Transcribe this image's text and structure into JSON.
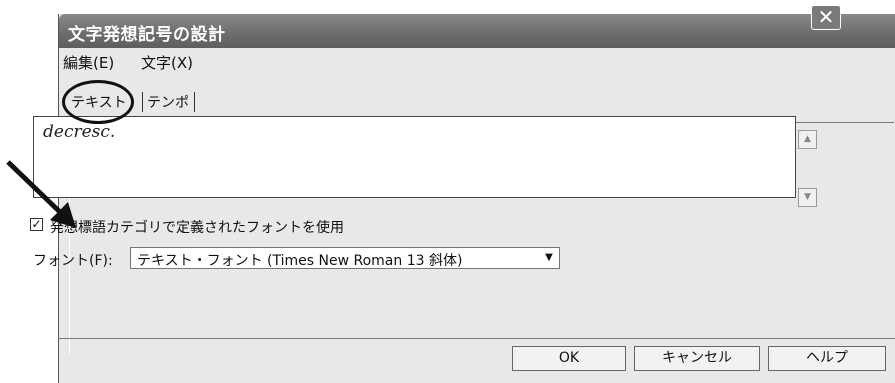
{
  "window": {
    "title": "文字発想記号の設計",
    "close_icon": "close-icon"
  },
  "menu": {
    "edit": "編集(E)",
    "char": "文字(X)"
  },
  "tabs": [
    {
      "label": "テキスト"
    },
    {
      "label": "テンポ"
    }
  ],
  "text_area": {
    "value": "decresc."
  },
  "checkbox": {
    "checked": true,
    "mark": "✓",
    "label": "発想標語カテゴリで定義されたフォントを使用"
  },
  "font": {
    "label": "フォント(F):",
    "value": "テキスト・フォント (Times New Roman 13 斜体)"
  },
  "buttons": {
    "ok": "OK",
    "cancel": "キャンセル",
    "help": "ヘルプ"
  }
}
